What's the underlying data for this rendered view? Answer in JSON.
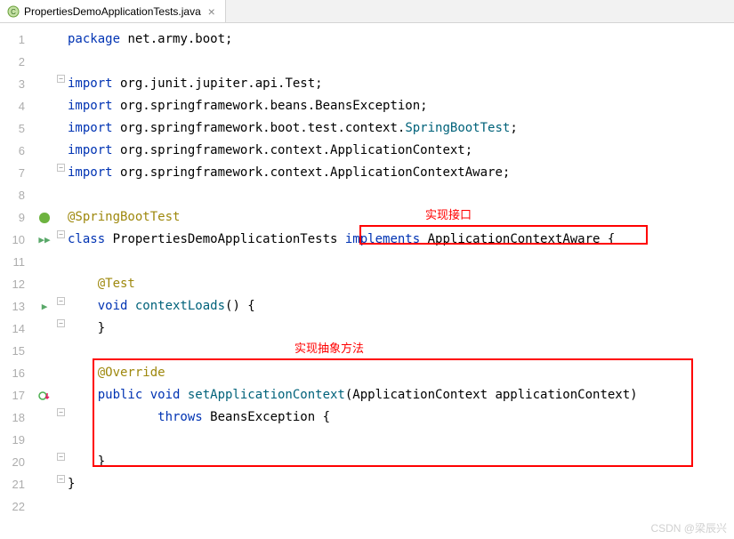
{
  "tab": {
    "filename": "PropertiesDemoApplicationTests.java",
    "close_glyph": "×"
  },
  "annotations": {
    "box1_label": "实现接口",
    "box2_label": "实现抽象方法"
  },
  "code": {
    "l1_kw": "package",
    "l1_rest": " net.army.boot;",
    "l3_kw": "import",
    "l3_rest": " org.junit.jupiter.api.Test;",
    "l4_kw": "import",
    "l4_rest": " org.springframework.beans.BeansException;",
    "l5_kw": "import",
    "l5_rest": " org.springframework.boot.test.context.",
    "l5_cls": "SpringBootTest",
    "l5_end": ";",
    "l6_kw": "import",
    "l6_rest": " org.springframework.context.ApplicationContext;",
    "l7_kw": "import",
    "l7_rest": " org.springframework.context.ApplicationContextAware;",
    "l9_ann": "@SpringBootTest",
    "l10_kw1": "class",
    "l10_name": " PropertiesDemoApplicationTests ",
    "l10_kw2": "implements",
    "l10_impl": " ApplicationContextAware ",
    "l10_end": "{",
    "l12_ann": "    @Test",
    "l13_kw": "    void ",
    "l13_fn": "contextLoads",
    "l13_end": "() {",
    "l14": "    }",
    "l16_ann": "    @Override",
    "l17_kw1": "    public void ",
    "l17_fn": "setApplicationContext",
    "l17_params": "(ApplicationContext applicationContext)",
    "l18_kw": "            throws ",
    "l18_ex": "BeansException {",
    "l20": "    }",
    "l21": "}"
  },
  "line_numbers": [
    "1",
    "2",
    "3",
    "4",
    "5",
    "6",
    "7",
    "8",
    "9",
    "10",
    "11",
    "12",
    "13",
    "14",
    "15",
    "16",
    "17",
    "18",
    "19",
    "20",
    "21",
    "22"
  ],
  "watermark": "CSDN @梁辰兴"
}
